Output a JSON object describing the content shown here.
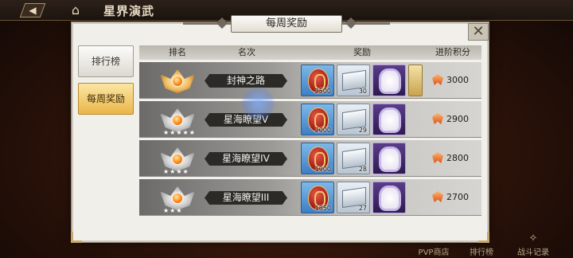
{
  "screen": {
    "title": "星界演武"
  },
  "modal": {
    "title": "每周奖励",
    "tabs": [
      {
        "label": "排行榜",
        "active": false
      },
      {
        "label": "每周奖励",
        "active": true
      }
    ],
    "columns": {
      "rank": "排名",
      "name": "名次",
      "rewards": "奖励",
      "points": "进阶积分"
    },
    "rows": [
      {
        "name": "封神之路",
        "badge": "gold",
        "rewards": [
          {
            "type": "egg",
            "count": "2500"
          },
          {
            "type": "crate",
            "count": "30"
          },
          {
            "type": "frame",
            "count": ""
          },
          {
            "type": "extra",
            "count": ""
          }
        ],
        "points": "3000"
      },
      {
        "name": "星海瞭望V",
        "badge": "silver",
        "rewards": [
          {
            "type": "egg",
            "count": "2000"
          },
          {
            "type": "crate",
            "count": "29"
          },
          {
            "type": "frame",
            "count": ""
          }
        ],
        "points": "2900"
      },
      {
        "name": "星海瞭望IV",
        "badge": "silver",
        "rewards": [
          {
            "type": "egg",
            "count": "1900"
          },
          {
            "type": "crate",
            "count": "28"
          },
          {
            "type": "frame",
            "count": ""
          }
        ],
        "points": "2800"
      },
      {
        "name": "星海瞭望III",
        "badge": "silver",
        "rewards": [
          {
            "type": "egg",
            "count": "1850"
          },
          {
            "type": "crate",
            "count": "27"
          },
          {
            "type": "frame",
            "count": ""
          }
        ],
        "points": "2700"
      }
    ]
  },
  "bottom_nav": [
    {
      "label": "PVP商店",
      "icon": "shop-icon"
    },
    {
      "label": "排行榜",
      "icon": "trophy-icon"
    },
    {
      "label": "战斗记录",
      "icon": "record-icon"
    }
  ],
  "colors": {
    "active_tab": "#eab648",
    "modal_bg": "#f1efea"
  }
}
